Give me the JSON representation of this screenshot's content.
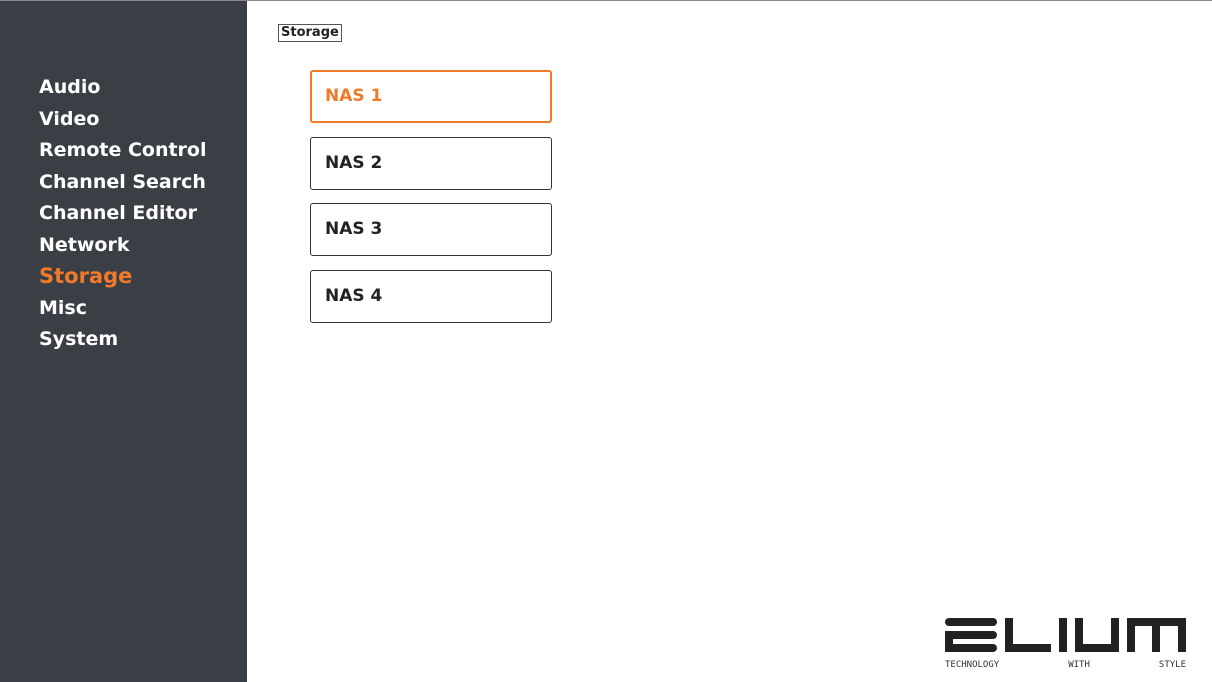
{
  "breadcrumb": "Storage",
  "sidebar": {
    "items": [
      {
        "label": "Audio"
      },
      {
        "label": "Video"
      },
      {
        "label": "Remote Control"
      },
      {
        "label": "Channel Search"
      },
      {
        "label": "Channel Editor"
      },
      {
        "label": "Network"
      },
      {
        "label": "Storage"
      },
      {
        "label": "Misc"
      },
      {
        "label": "System"
      }
    ],
    "active": "Storage"
  },
  "nas": {
    "items": [
      {
        "label": "NAS 1"
      },
      {
        "label": "NAS 2"
      },
      {
        "label": "NAS 3"
      },
      {
        "label": "NAS 4"
      }
    ],
    "selected": "NAS 1"
  },
  "brand": {
    "name": "ELIUM",
    "tagline": "TECHNOLOGY WITH STYLE"
  },
  "colors": {
    "accent": "#f07a2a",
    "sidebar_bg": "#3a3f46",
    "text_light": "#ffffff",
    "text_dark": "#222222"
  }
}
